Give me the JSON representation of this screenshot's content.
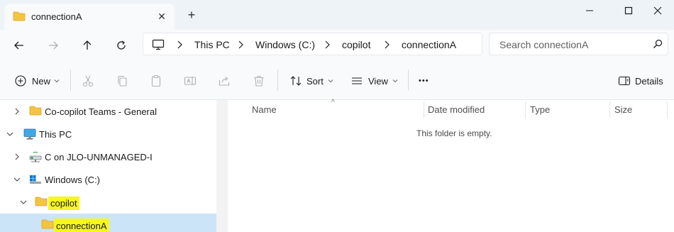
{
  "tab": {
    "title": "connectionA",
    "icon": "folder-icon",
    "close_glyph": "✕",
    "new_tab_glyph": "+"
  },
  "window": {
    "minimize": "minimize-icon",
    "maximize": "maximize-icon",
    "close": "close-icon"
  },
  "address": {
    "crumbs": [
      "This PC",
      "Windows (C:)",
      "copilot",
      "connectionA"
    ]
  },
  "search": {
    "placeholder": "Search connectionA"
  },
  "toolbar": {
    "new_label": "New",
    "sort_label": "Sort",
    "view_label": "View",
    "more_glyph": "•••",
    "details_label": "Details"
  },
  "tree": [
    {
      "label": "Co-copilot Teams - General",
      "icon": "folder-icon",
      "expanded": false
    },
    {
      "label": "This PC",
      "icon": "computer-icon",
      "expanded": true
    },
    {
      "label": "C on JLO-UNMANAGED-I",
      "icon": "network-drive-icon",
      "expanded": false
    },
    {
      "label": "Windows (C:)",
      "icon": "drive-icon",
      "expanded": true
    },
    {
      "label": "copilot",
      "icon": "folder-icon",
      "expanded": true,
      "highlighted": true
    },
    {
      "label": "connectionA",
      "icon": "folder-icon",
      "selected": true,
      "highlighted": true
    }
  ],
  "columns": {
    "name": "Name",
    "date": "Date modified",
    "type": "Type",
    "size": "Size"
  },
  "content": {
    "empty_message": "This folder is empty."
  },
  "colors": {
    "selection": "#cce4f7",
    "highlight": "#f7f71f",
    "folder": "#f4c443",
    "accent": "#0067c0"
  }
}
